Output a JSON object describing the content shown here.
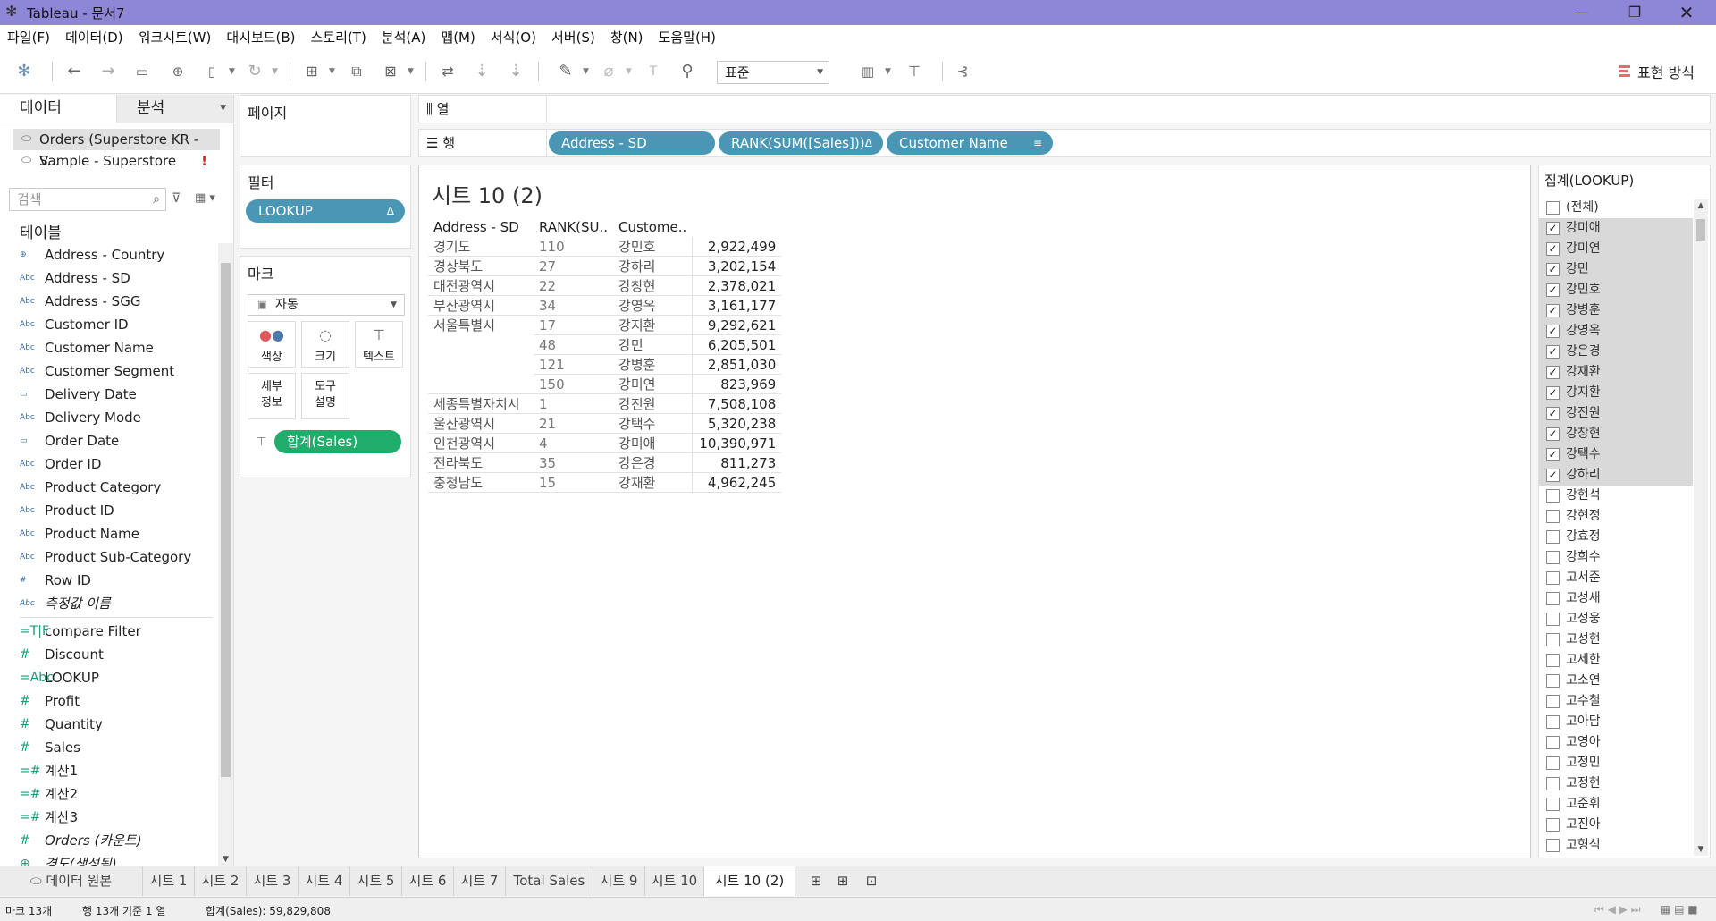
{
  "window": {
    "title": "Tableau - 문서7"
  },
  "menu": [
    "파일(F)",
    "데이터(D)",
    "워크시트(W)",
    "대시보드(B)",
    "스토리(T)",
    "분석(A)",
    "맵(M)",
    "서식(O)",
    "서버(S)",
    "창(N)",
    "도움말(H)"
  ],
  "toolbar": {
    "fit_value": "표준",
    "show_me_label": "표현 방식"
  },
  "data_pane": {
    "tab_data": "데이터",
    "tab_analysis": "분석",
    "datasources": [
      {
        "name": "Orders (Superstore KR - V..."
      },
      {
        "name": "Sample - Superstore",
        "warning": "!"
      }
    ],
    "search_placeholder": "검색",
    "tables_label": "테이블",
    "dimensions": [
      {
        "type": "geo",
        "name": "Address - Country"
      },
      {
        "type": "Abc",
        "name": "Address - SD"
      },
      {
        "type": "Abc",
        "name": "Address - SGG"
      },
      {
        "type": "Abc",
        "name": "Customer ID"
      },
      {
        "type": "Abc",
        "name": "Customer Name"
      },
      {
        "type": "Abc",
        "name": "Customer Segment"
      },
      {
        "type": "date",
        "name": "Delivery Date"
      },
      {
        "type": "Abc",
        "name": "Delivery Mode"
      },
      {
        "type": "date",
        "name": "Order Date"
      },
      {
        "type": "Abc",
        "name": "Order ID"
      },
      {
        "type": "Abc",
        "name": "Product Category"
      },
      {
        "type": "Abc",
        "name": "Product ID"
      },
      {
        "type": "Abc",
        "name": "Product Name"
      },
      {
        "type": "Abc",
        "name": "Product Sub-Category"
      },
      {
        "type": "#",
        "name": "Row ID"
      },
      {
        "type": "Abc",
        "name": "측정값 이름"
      }
    ],
    "measures": [
      {
        "type": "=T|F",
        "name": "compare Filter"
      },
      {
        "type": "#",
        "name": "Discount"
      },
      {
        "type": "=Abc",
        "name": "LOOKUP"
      },
      {
        "type": "#",
        "name": "Profit"
      },
      {
        "type": "#",
        "name": "Quantity"
      },
      {
        "type": "#",
        "name": "Sales"
      },
      {
        "type": "=#",
        "name": "계산1"
      },
      {
        "type": "=#",
        "name": "계산2"
      },
      {
        "type": "=#",
        "name": "계산3"
      },
      {
        "type": "#",
        "name": "Orders (카운트)"
      },
      {
        "type": "geo",
        "name": "경도(생성됨)"
      }
    ]
  },
  "pages_label": "페이지",
  "filters": {
    "title": "필터",
    "pill": "LOOKUP",
    "pill_mark": "Δ"
  },
  "marks": {
    "title": "마크",
    "type": "자동",
    "buttons": {
      "color": "색상",
      "size": "크기",
      "text": "텍스트",
      "detail": "세부\n정보",
      "tooltip": "도구\n설명"
    },
    "pill": "합계(Sales)"
  },
  "columns_shelf": {
    "label": "열"
  },
  "rows_shelf": {
    "label": "행",
    "pills": [
      {
        "text": "Address - SD",
        "mark": ""
      },
      {
        "text": "RANK(SUM([Sales]))",
        "mark": "Δ"
      },
      {
        "text": "Customer Name",
        "mark": "≡"
      }
    ]
  },
  "viz": {
    "title": "시트 10 (2)",
    "headers": [
      "Address - SD",
      "RANK(SU..",
      "Custome.."
    ],
    "rows": [
      {
        "sd": "경기도",
        "rank": "110",
        "name": "강민호",
        "sales": "2,922,499"
      },
      {
        "sd": "경상북도",
        "rank": "27",
        "name": "강하리",
        "sales": "3,202,154"
      },
      {
        "sd": "대전광역시",
        "rank": "22",
        "name": "강창현",
        "sales": "2,378,021"
      },
      {
        "sd": "부산광역시",
        "rank": "34",
        "name": "강영옥",
        "sales": "3,161,177"
      },
      {
        "sd": "서울특별시",
        "rank": "17",
        "name": "강지환",
        "sales": "9,292,621"
      },
      {
        "sd": "",
        "rank": "48",
        "name": "강민",
        "sales": "6,205,501"
      },
      {
        "sd": "",
        "rank": "121",
        "name": "강병훈",
        "sales": "2,851,030"
      },
      {
        "sd": "",
        "rank": "150",
        "name": "강미연",
        "sales": "823,969"
      },
      {
        "sd": "세종특별자치시",
        "rank": "1",
        "name": "강진원",
        "sales": "7,508,108"
      },
      {
        "sd": "울산광역시",
        "rank": "21",
        "name": "강택수",
        "sales": "5,320,238"
      },
      {
        "sd": "인천광역시",
        "rank": "4",
        "name": "강미애",
        "sales": "10,390,971"
      },
      {
        "sd": "전라북도",
        "rank": "35",
        "name": "강은경",
        "sales": "811,273"
      },
      {
        "sd": "충청남도",
        "rank": "15",
        "name": "강재환",
        "sales": "4,962,245"
      }
    ]
  },
  "lookup_filter": {
    "title": "집계(LOOKUP)",
    "items": [
      {
        "label": "(전체)",
        "checked": false
      },
      {
        "label": "강미애",
        "checked": true
      },
      {
        "label": "강미연",
        "checked": true
      },
      {
        "label": "강민",
        "checked": true
      },
      {
        "label": "강민호",
        "checked": true
      },
      {
        "label": "강병훈",
        "checked": true
      },
      {
        "label": "강영옥",
        "checked": true
      },
      {
        "label": "강은경",
        "checked": true
      },
      {
        "label": "강재환",
        "checked": true
      },
      {
        "label": "강지환",
        "checked": true
      },
      {
        "label": "강진원",
        "checked": true
      },
      {
        "label": "강창현",
        "checked": true
      },
      {
        "label": "강택수",
        "checked": true
      },
      {
        "label": "강하리",
        "checked": true
      },
      {
        "label": "강현석",
        "checked": false
      },
      {
        "label": "강현정",
        "checked": false
      },
      {
        "label": "강효정",
        "checked": false
      },
      {
        "label": "강희수",
        "checked": false
      },
      {
        "label": "고서준",
        "checked": false
      },
      {
        "label": "고성새",
        "checked": false
      },
      {
        "label": "고성웅",
        "checked": false
      },
      {
        "label": "고성현",
        "checked": false
      },
      {
        "label": "고세한",
        "checked": false
      },
      {
        "label": "고소연",
        "checked": false
      },
      {
        "label": "고수철",
        "checked": false
      },
      {
        "label": "고아담",
        "checked": false
      },
      {
        "label": "고영아",
        "checked": false
      },
      {
        "label": "고정민",
        "checked": false
      },
      {
        "label": "고정현",
        "checked": false
      },
      {
        "label": "고준휘",
        "checked": false
      },
      {
        "label": "고진아",
        "checked": false
      },
      {
        "label": "고형석",
        "checked": false
      }
    ]
  },
  "sheet_tabs": [
    "데이터 원본",
    "시트 1",
    "시트 2",
    "시트 3",
    "시트 4",
    "시트 5",
    "시트 6",
    "시트 7",
    "Total Sales",
    "시트 9",
    "시트 10",
    "시트 10 (2)"
  ],
  "active_sheet": "시트 10 (2)",
  "status": {
    "marks": "마크 13개",
    "rows_cols": "행 13개 기준 1 열",
    "sum": "합계(Sales): 59,829,808"
  }
}
